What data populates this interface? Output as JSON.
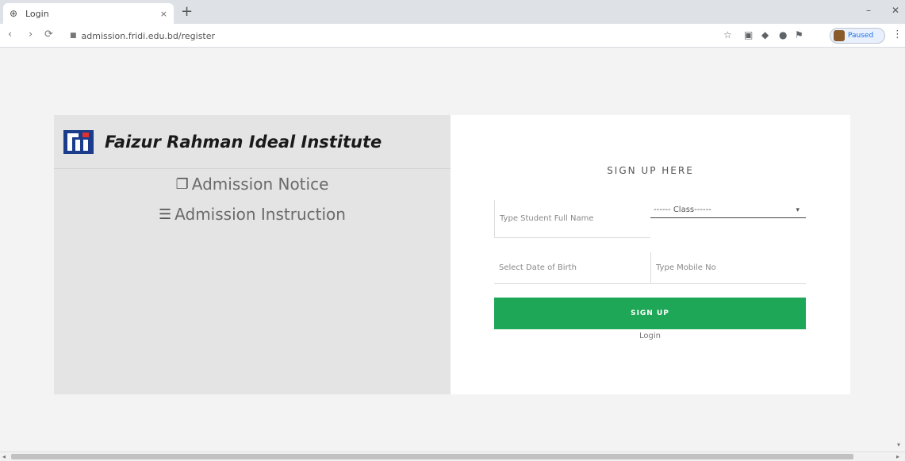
{
  "browser": {
    "tab_title": "Login",
    "tab_close": "×",
    "new_tab": "+",
    "minimize": "–",
    "close_window": "✕",
    "back": "‹",
    "forward": "›",
    "reload": "⟳",
    "url": "admission.fridi.edu.bd/register",
    "profile_label": "Paused",
    "menu": "⋮"
  },
  "brand": {
    "name": "Faizur Rahman Ideal Institute"
  },
  "menu": {
    "admission_notice": "Admission Notice",
    "admission_instruction": "Admission Instruction"
  },
  "form": {
    "title": "SIGN UP HERE",
    "student_name_placeholder": "Type Student Full Name",
    "class_select": "------ Class------",
    "dob_placeholder": "Select Date of Birth",
    "mobile_placeholder": "Type Mobile No",
    "signup_button": "SIGN UP",
    "login_link": "Login"
  },
  "colors": {
    "brand_blue": "#1b3c8a",
    "signup_green": "#1ea757"
  },
  "icons": {
    "notice": "copy-icon",
    "instruction": "list-icon"
  }
}
